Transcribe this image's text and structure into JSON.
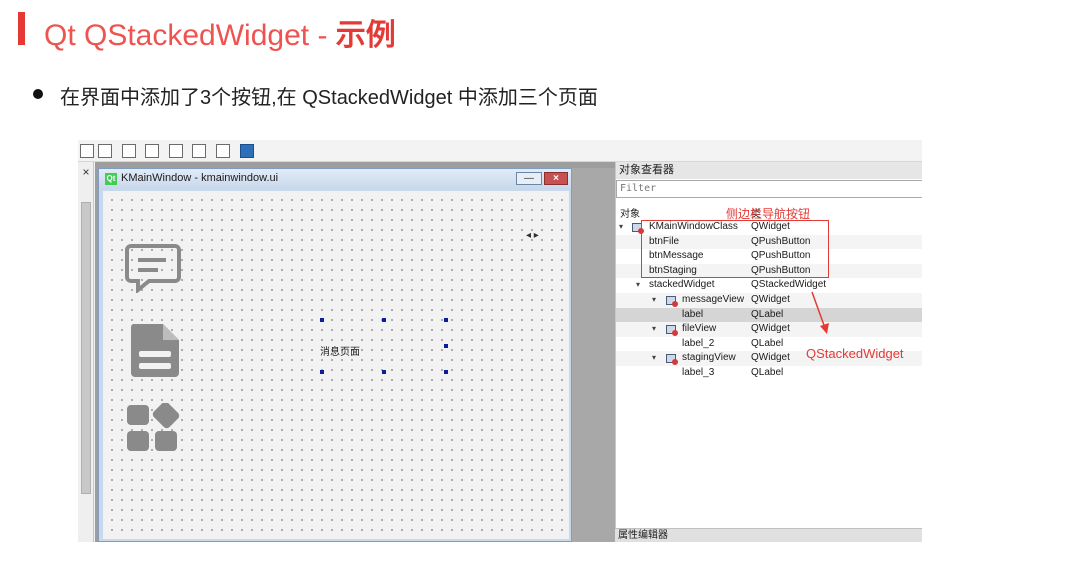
{
  "slide": {
    "title_prefix": "Qt QStackedWidget - ",
    "title_emphasis": "示例",
    "bullet": "在界面中添加了3个按钮,在 QStackedWidget 中添加三个页面"
  },
  "designer": {
    "left_close": "×",
    "form_title": "KMainWindow - kmainwindow.ui",
    "qt_logo": "Qt",
    "minimize": "—",
    "close": "×",
    "canvas_label": "消息页面",
    "resize_mark": "◂ ▸",
    "nav_icons": [
      "message-icon",
      "file-icon",
      "apps-icon"
    ]
  },
  "inspector": {
    "title": "对象查看器",
    "filter_placeholder": "Filter",
    "col_object": "对象",
    "col_class": "类",
    "rows": [
      {
        "name": "KMainWindowClass",
        "cls": "QWidget"
      },
      {
        "name": "btnFile",
        "cls": "QPushButton"
      },
      {
        "name": "btnMessage",
        "cls": "QPushButton"
      },
      {
        "name": "btnStaging",
        "cls": "QPushButton"
      },
      {
        "name": "stackedWidget",
        "cls": "QStackedWidget"
      },
      {
        "name": "messageView",
        "cls": "QWidget"
      },
      {
        "name": "label",
        "cls": "QLabel"
      },
      {
        "name": "fileView",
        "cls": "QWidget"
      },
      {
        "name": "label_2",
        "cls": "QLabel"
      },
      {
        "name": "stagingView",
        "cls": "QWidget"
      },
      {
        "name": "label_3",
        "cls": "QLabel"
      }
    ],
    "footer": "属性编辑器"
  },
  "annotations": {
    "nav_buttons": "侧边栏导航按钮",
    "stacked": "QStackedWidget",
    "color": "#e53935"
  }
}
